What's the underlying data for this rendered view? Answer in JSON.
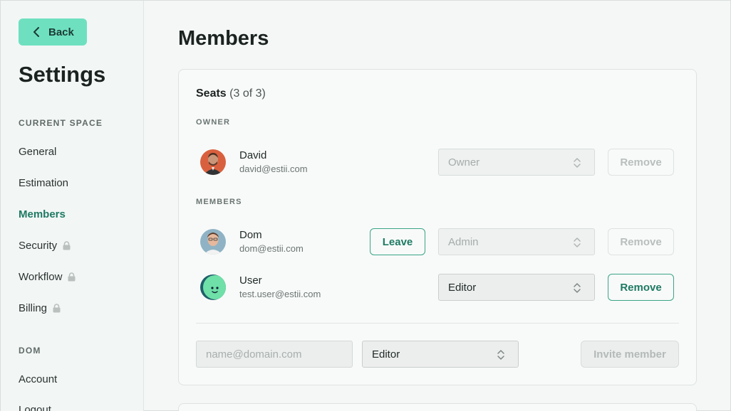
{
  "sidebar": {
    "back_label": "Back",
    "title": "Settings",
    "current_space_label": "CURRENT SPACE",
    "items": [
      {
        "label": "General"
      },
      {
        "label": "Estimation"
      },
      {
        "label": "Members"
      },
      {
        "label": "Security"
      },
      {
        "label": "Workflow"
      },
      {
        "label": "Billing"
      }
    ],
    "user_section_label": "DOM",
    "user_items": [
      {
        "label": "Account"
      },
      {
        "label": "Logout"
      }
    ]
  },
  "main": {
    "title": "Members",
    "seats": {
      "label": "Seats",
      "count": "(3 of 3)"
    },
    "owner_label": "OWNER",
    "members_label": "MEMBERS",
    "owner": {
      "name": "David",
      "email": "david@estii.com",
      "role": "Owner",
      "remove_label": "Remove"
    },
    "members": [
      {
        "name": "Dom",
        "email": "dom@estii.com",
        "role": "Admin",
        "leave_label": "Leave",
        "remove_label": "Remove"
      },
      {
        "name": "User",
        "email": "test.user@estii.com",
        "role": "Editor",
        "remove_label": "Remove"
      }
    ],
    "invite": {
      "placeholder": "name@domain.com",
      "role": "Editor",
      "button_label": "Invite member"
    }
  },
  "colors": {
    "accent": "#6ee0c0",
    "active_nav": "#1e7a63",
    "outline_button": "#3aa487"
  },
  "icons": {
    "back": "chevron-left-icon",
    "locked": "lock-icon",
    "select": "chevron-up-down-icon"
  }
}
